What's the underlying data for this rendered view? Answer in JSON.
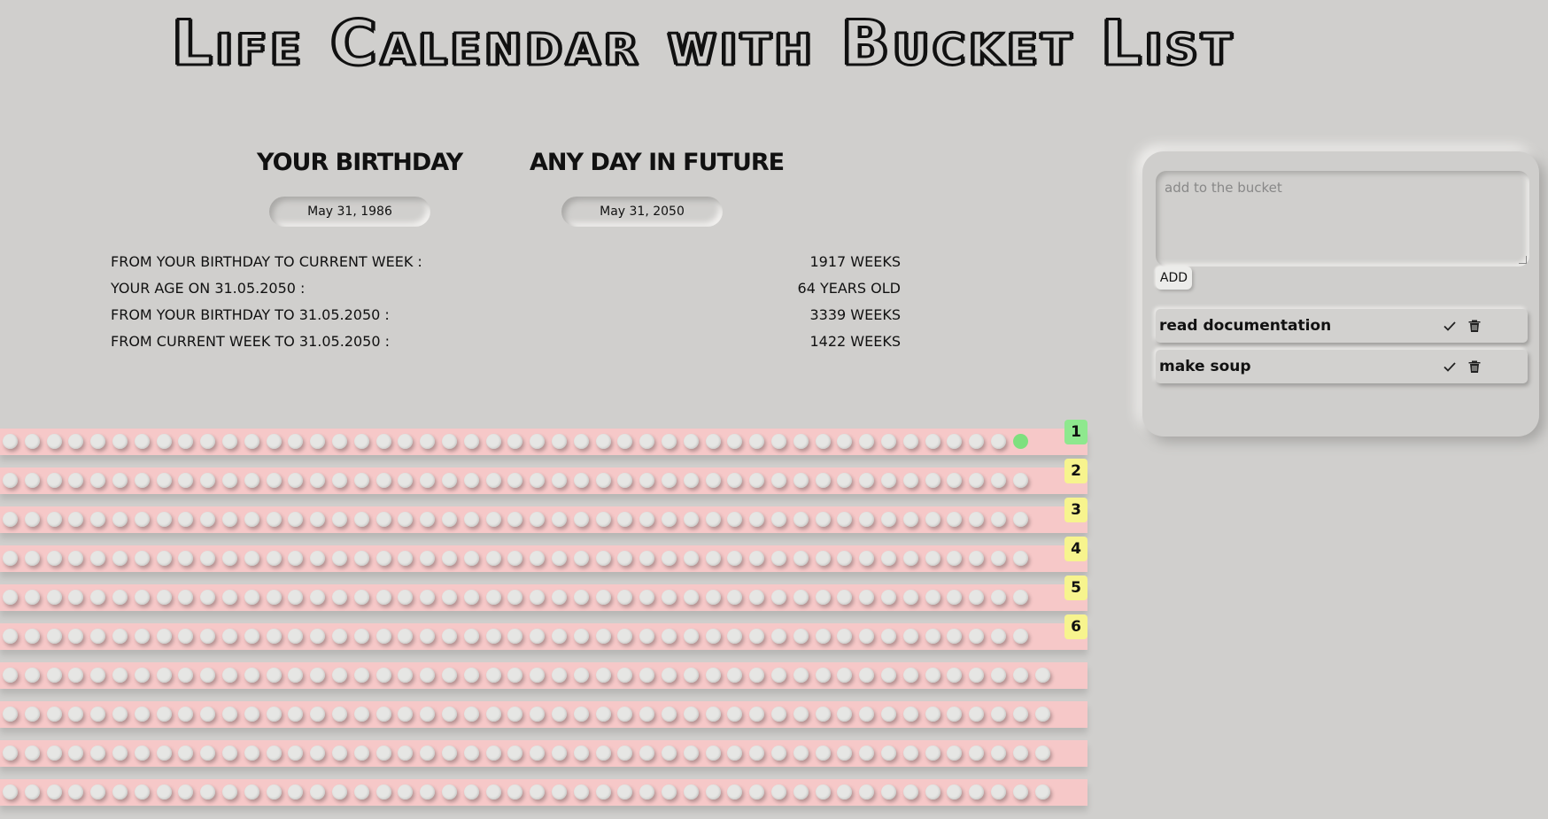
{
  "title": "Life Calendar with Bucket List",
  "birthday": {
    "heading": "YOUR BIRTHDAY",
    "value": "May 31, 1986"
  },
  "future": {
    "heading": "ANY DAY IN FUTURE",
    "value": "May 31, 2050"
  },
  "stats": [
    {
      "label": "FROM YOUR BIRTHDAY TO CURRENT WEEK :",
      "value": "1917 WEEKS"
    },
    {
      "label": "YOUR AGE ON 31.05.2050 :",
      "value": "64 YEARS OLD"
    },
    {
      "label": "FROM YOUR BIRTHDAY TO 31.05.2050 :",
      "value": "3339 WEEKS"
    },
    {
      "label": "FROM CURRENT WEEK TO 31.05.2050 :",
      "value": "1422 WEEKS"
    }
  ],
  "calendar": {
    "weeks_per_row": 48,
    "badges": [
      "1",
      "2",
      "3",
      "4",
      "5",
      "6"
    ],
    "unlabeled_rows_visible": 4,
    "colors": {
      "row": "#f6c8c8",
      "current": "#7ee07e",
      "first_badge": "#8ee88e",
      "badge": "#f7f48e"
    }
  },
  "bucket": {
    "placeholder": "add to the bucket",
    "add_label": "ADD",
    "items": [
      "read documentation",
      "make soup"
    ]
  },
  "icons": [
    "check-icon",
    "trash-icon"
  ]
}
